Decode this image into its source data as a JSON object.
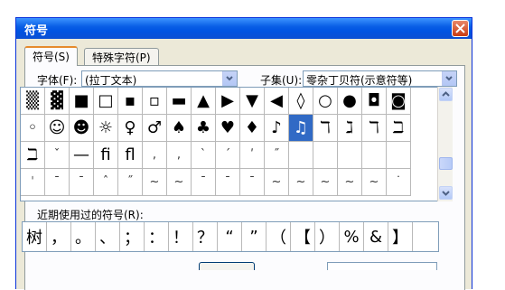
{
  "window": {
    "title": "符号",
    "close_label": "✕"
  },
  "tabs": [
    {
      "label": "符号(S)"
    },
    {
      "label": "特殊字符(P)"
    }
  ],
  "font": {
    "label": "字体(F):",
    "value": "(拉丁文本)"
  },
  "subset": {
    "label": "子集(U):",
    "value": "零杂丁贝符(示意符等)"
  },
  "symbols": [
    [
      "▒",
      "▓",
      "■",
      "□",
      "▪",
      "▫",
      "▬",
      "▲",
      "▶",
      "▼",
      "◀",
      "◊",
      "○",
      "●",
      "◘",
      "◙"
    ],
    [
      "◦",
      "☺",
      "☻",
      "☼",
      "♀",
      "♂",
      "♠",
      "♣",
      "♥",
      "♦",
      "♪",
      "♫",
      "ℸ",
      "ℷ",
      "ℸ",
      "ℶ"
    ],
    [
      "ℶ",
      "ˇ",
      "—",
      "ﬁ",
      "ﬂ",
      ",",
      ",",
      "`",
      "´",
      "ʹ",
      "˝",
      "",
      "",
      "",
      "",
      ""
    ],
    [
      "ˈ",
      "ˉ",
      "ˉ",
      "ˆ",
      "˝",
      "~",
      "~",
      "ˉ",
      "ˉ",
      "ˉ",
      "~",
      "~",
      "~",
      "~",
      "~",
      "˙"
    ]
  ],
  "selected_symbol": "♫",
  "recent": {
    "label": "近期使用过的符号(R):",
    "symbols": [
      "树",
      "，",
      "。",
      "、",
      "；",
      "：",
      "！",
      "？",
      "“",
      "”",
      "（",
      "【",
      "）",
      "%",
      "&",
      "】"
    ]
  }
}
